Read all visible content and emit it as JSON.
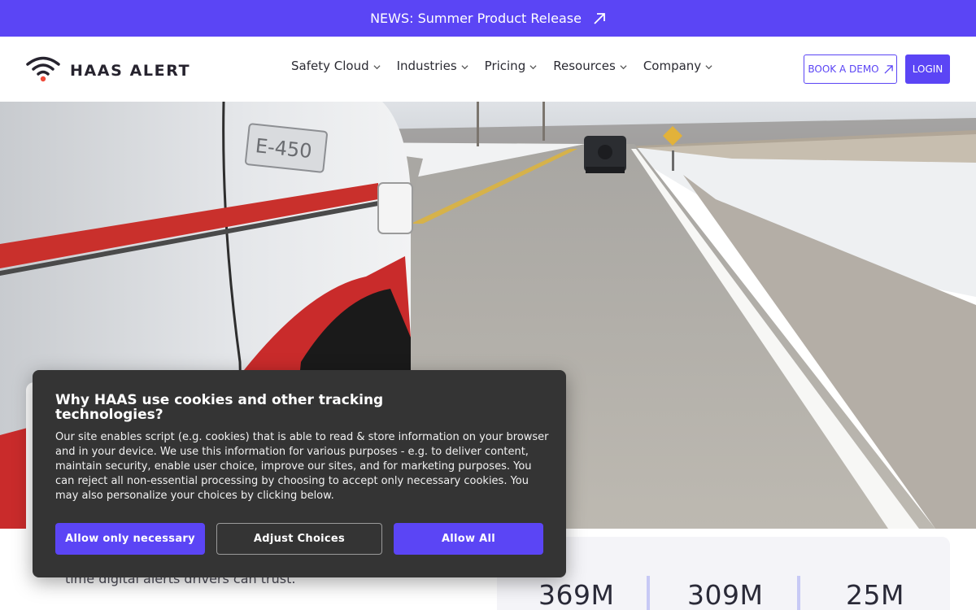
{
  "news": {
    "text": "NEWS: Summer Product Release",
    "icon": "arrow-up-right-icon"
  },
  "header": {
    "logo_text": "HAAS ALERT",
    "logo_icon": "wifi-signal-icon",
    "nav": [
      {
        "label": "Safety Cloud",
        "icon": "chevron-down-icon"
      },
      {
        "label": "Industries",
        "icon": "chevron-down-icon"
      },
      {
        "label": "Pricing",
        "icon": "chevron-down-icon"
      },
      {
        "label": "Resources",
        "icon": "chevron-down-icon"
      },
      {
        "label": "Company",
        "icon": "chevron-down-icon"
      }
    ],
    "book_demo": "BOOK A DEMO",
    "login": "LOGIN"
  },
  "hero": {
    "vehicle_badge": "E-450"
  },
  "intro": {
    "text": "time digital alerts drivers can trust."
  },
  "stats": [
    {
      "value": "369M"
    },
    {
      "value": "309M"
    },
    {
      "value": "25M"
    }
  ],
  "cookie": {
    "title": "Why HAAS use cookies and other tracking technologies?",
    "body": "Our site enables script (e.g. cookies) that is able to read & store information on your browser and in your device. We use this information for various purposes - e.g. to deliver content, maintain security, enable user choice, improve our sites, and for marketing purposes. You can reject all non-essential processing by choosing to accept only necessary cookies. You may also personalize your choices by clicking below.",
    "buttons": {
      "necessary": "Allow only necessary",
      "adjust": "Adjust Choices",
      "all": "Allow All"
    }
  },
  "colors": {
    "brand": "#5b45f5",
    "dialog_bg": "#343434",
    "logo_dot": "#ef4b3a"
  }
}
